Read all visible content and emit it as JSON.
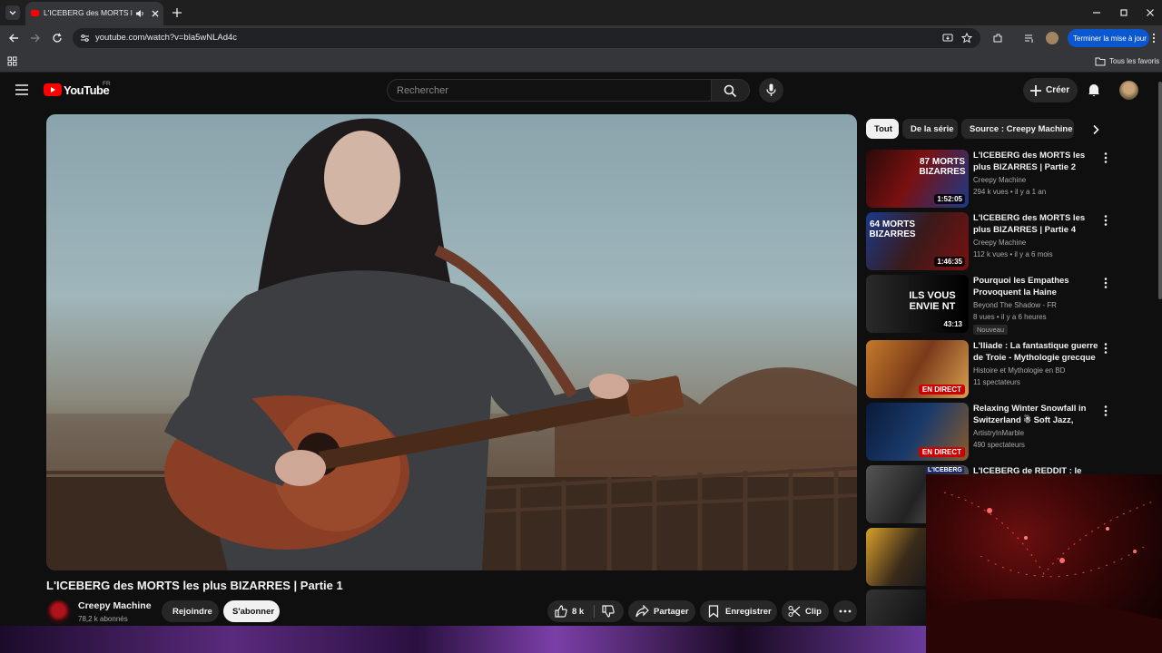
{
  "browser": {
    "tab_title": "L'ICEBERG des MORTS les p",
    "url": "youtube.com/watch?v=bla5wNLAd4c",
    "update_button": "Terminer la mise à jour",
    "bookmarks_all": "Tous les favoris"
  },
  "youtube": {
    "logo_text": "YouTube",
    "logo_region": "FR",
    "search_placeholder": "Rechercher",
    "create_label": "Créer"
  },
  "video": {
    "title": "L'ICEBERG des MORTS les plus BIZARRES | Partie 1",
    "channel_name": "Creepy Machine",
    "subscribers": "78,2 k abonnés",
    "join_label": "Rejoindre",
    "subscribe_label": "S'abonner",
    "likes": "8 k",
    "share_label": "Partager",
    "save_label": "Enregistrer",
    "clip_label": "Clip"
  },
  "chips": [
    "Tout",
    "De la série",
    "Source : Creepy Machine"
  ],
  "recommendations": [
    {
      "title": "L'ICEBERG des MORTS les plus BIZARRES | Partie 2",
      "channel": "Creepy Machine",
      "meta": "294 k vues • il y a 1 an",
      "duration": "1:52:05",
      "thumb_text": "87 MORTS BIZARRES"
    },
    {
      "title": "L'ICEBERG des MORTS les plus BIZARRES | Partie 4",
      "channel": "Creepy Machine",
      "meta": "112 k vues • il y a 6 mois",
      "duration": "1:46:35",
      "thumb_text": "64 MORTS BIZARRES"
    },
    {
      "title": "Pourquoi les Empathes Provoquent la Haine Silencieu…",
      "channel": "Beyond The Shadow - FR",
      "meta": "8 vues • il y a 6 heures",
      "duration": "43:13",
      "badge": "Nouveau",
      "thumb_text": "ILS VOUS ENVIE NT"
    },
    {
      "title": "L'Iliade : La fantastique guerre de Troie - Mythologie grecque",
      "channel": "Histoire et Mythologie en BD",
      "meta": "11 spectateurs",
      "live": "EN DIRECT"
    },
    {
      "title": "Relaxing Winter Snowfall in Switzerland ☃ Soft Jazz, Coz…",
      "channel": "ArtistryInMarble",
      "meta": "490 spectateurs",
      "live": "EN DIRECT"
    },
    {
      "title": "L'ICEBERG de REDDIT : le site le",
      "channel": "",
      "meta": "",
      "thumb_text": "L'ICEBERG"
    }
  ],
  "colors": {
    "bg": "#0f0f0f",
    "accent_red": "#ff0000",
    "update_blue": "#0b57d0"
  }
}
